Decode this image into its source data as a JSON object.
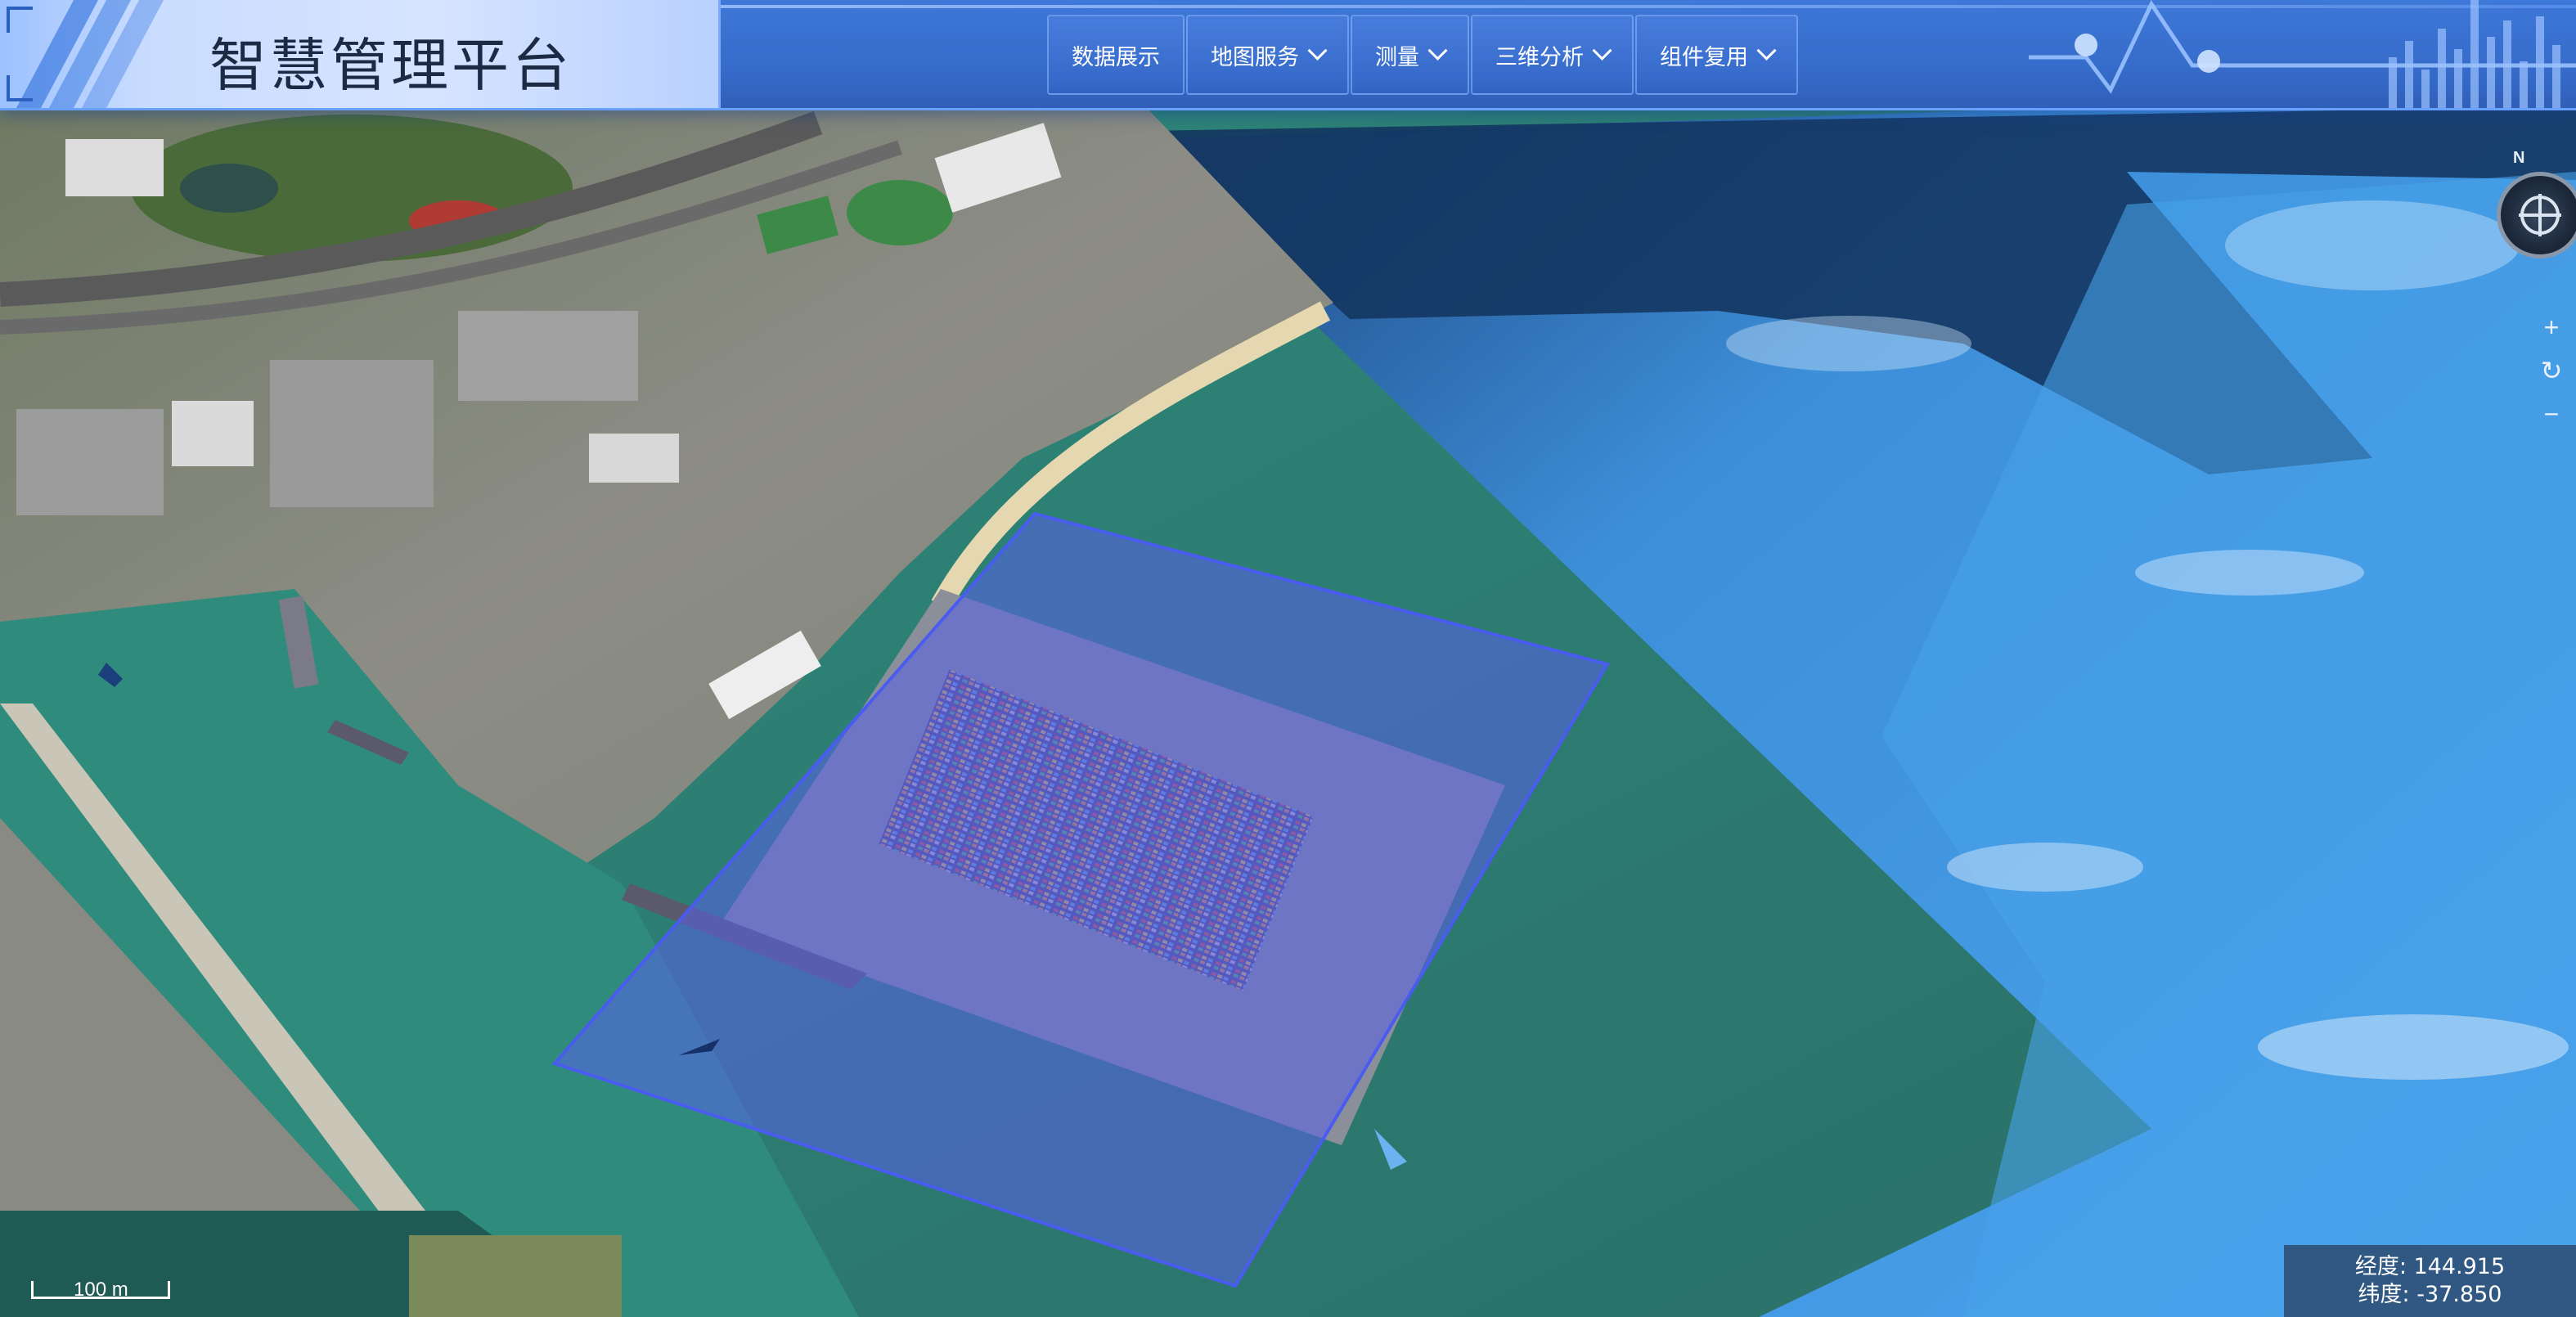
{
  "header": {
    "title": "智慧管理平台",
    "nav": [
      {
        "label": "数据展示",
        "has_dropdown": false
      },
      {
        "label": "地图服务",
        "has_dropdown": true
      },
      {
        "label": "测量",
        "has_dropdown": true
      },
      {
        "label": "三维分析",
        "has_dropdown": true
      },
      {
        "label": "组件复用",
        "has_dropdown": true
      }
    ]
  },
  "map_controls": {
    "compass_north": "N",
    "zoom_in": "+",
    "reset": "↻",
    "zoom_out": "−"
  },
  "scale_bar": {
    "label": "100 m"
  },
  "coordinates": {
    "longitude_label": "经度: 144.915",
    "latitude_label": "纬度: -37.850"
  },
  "colors": {
    "header_blue": "#3e78d8",
    "water_green": "#2f7f73",
    "sea_blue": "#3e95e0",
    "selection_polygon": "#5560e8"
  },
  "icons": [
    "compass-icon",
    "chevron-down-icon",
    "zoom-in-icon",
    "reset-icon",
    "zoom-out-icon"
  ]
}
